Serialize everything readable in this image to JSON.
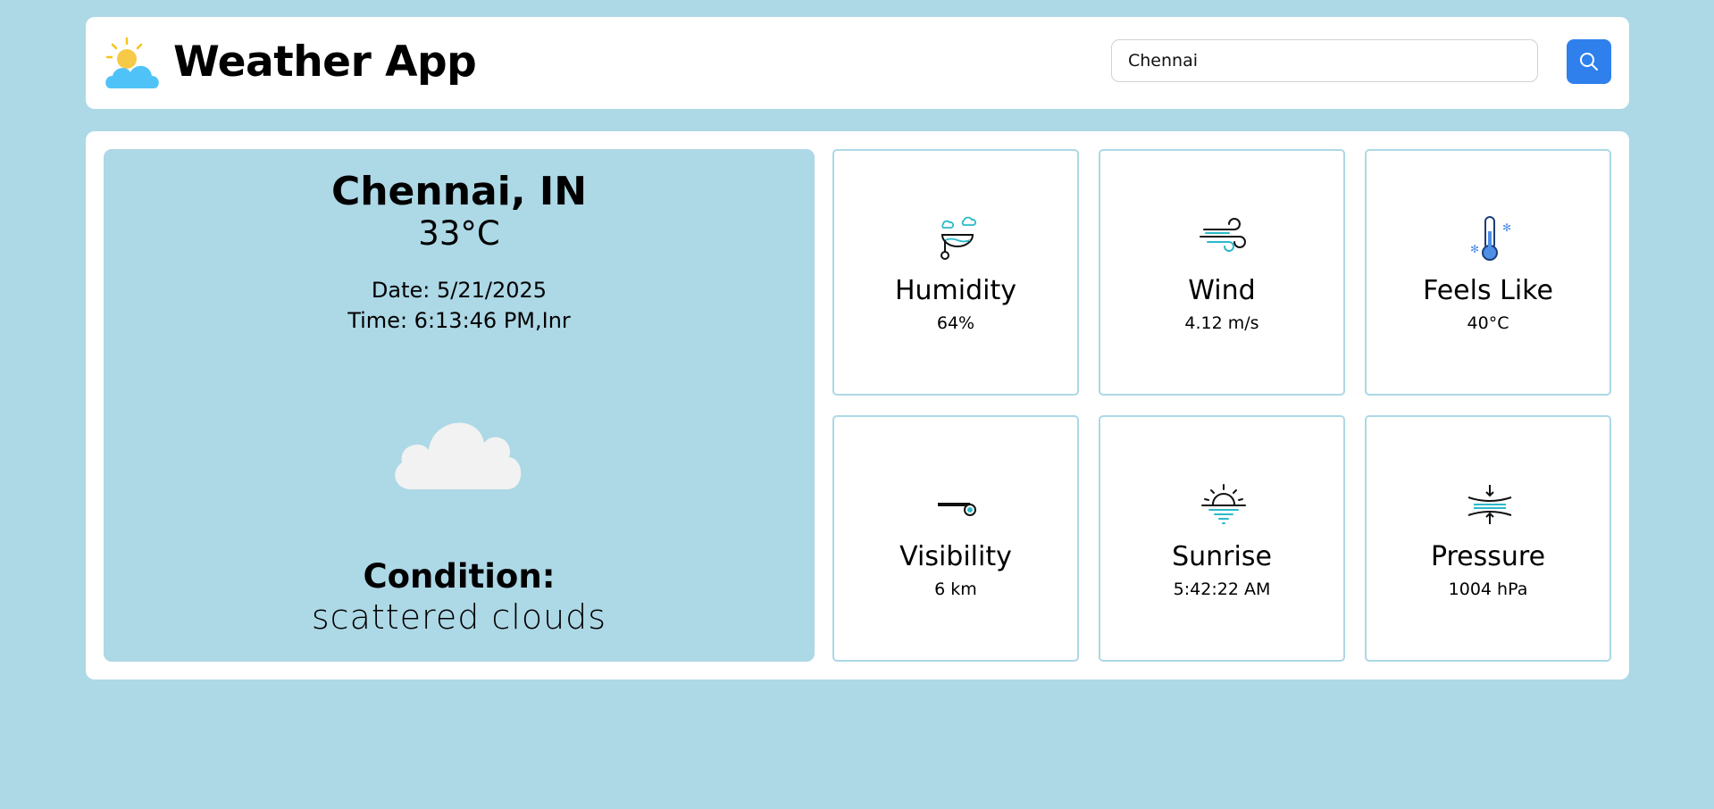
{
  "header": {
    "logo_icon": "sun-cloud-icon",
    "title": "Weather App",
    "search": {
      "value": "Chennai",
      "placeholder": ""
    },
    "search_icon": "search-icon",
    "accent_color": "#2f80ed"
  },
  "current": {
    "city": "Chennai, IN",
    "temp": "33°C",
    "date": "Date: 5/21/2025",
    "time": "Time: 6:13:46 PM,Inr",
    "weather_icon": "cloud-icon",
    "condition_label": "Condition:",
    "condition_value": "scattered clouds"
  },
  "cards": [
    {
      "icon": "humidity-icon",
      "label": "Humidity",
      "value": "64%"
    },
    {
      "icon": "wind-icon",
      "label": "Wind",
      "value": "4.12 m/s"
    },
    {
      "icon": "thermometer-icon",
      "label": "Feels Like",
      "value": "40°C"
    },
    {
      "icon": "visibility-icon",
      "label": "Visibility",
      "value": "6 km"
    },
    {
      "icon": "sunrise-icon",
      "label": "Sunrise",
      "value": "5:42:22 AM"
    },
    {
      "icon": "pressure-icon",
      "label": "Pressure",
      "value": "1004 hPa"
    }
  ],
  "colors": {
    "background": "#add8e6",
    "panel": "#ffffff",
    "accent": "#2f80ed"
  }
}
